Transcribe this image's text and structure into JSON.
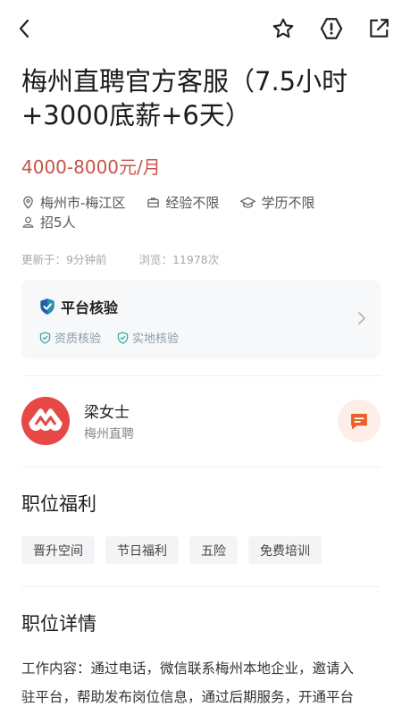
{
  "topbar": {
    "back_icon": "chevron-left-icon",
    "favorite_icon": "star-icon",
    "report_icon": "alert-hexagon-icon",
    "share_icon": "share-external-icon"
  },
  "job": {
    "title_line1": "梅州直聘官方客服（7.5小时",
    "title_line2": "+3000底薪+6天）",
    "salary": "4000-8000元/月",
    "location": "梅州市-梅江区",
    "experience": "经验不限",
    "education": "学历不限",
    "headcount": "招5人",
    "updated_label": "更新于：",
    "updated_value": "9分钟前",
    "views_label": "浏览：",
    "views_value": "11978次"
  },
  "verify": {
    "title": "平台核验",
    "items": [
      "资质核验",
      "实地核验"
    ]
  },
  "contact": {
    "name": "梁女士",
    "company": "梅州直聘"
  },
  "benefits": {
    "title": "职位福利",
    "tags": [
      "晋升空间",
      "节日福利",
      "五险",
      "免费培训"
    ]
  },
  "details": {
    "title": "职位详情",
    "line1": "工作内容：通过电话，微信联系梅州本地企业，邀请入",
    "line2": "驻平台，帮助发布岗位信息，通过后期服务，开通平台"
  },
  "colors": {
    "salary": "#c8534a",
    "accent": "#e8622c",
    "verify_shield": "#1f5fa8",
    "avatar_bg": "#e64846"
  }
}
